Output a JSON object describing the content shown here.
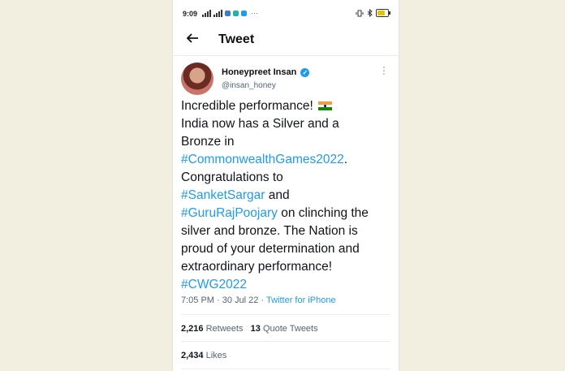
{
  "status_bar": {
    "time": "9:09",
    "dots": "···"
  },
  "header": {
    "title": "Tweet"
  },
  "tweet": {
    "display_name": "Honeypreet  Insan",
    "handle": "@insan_honey",
    "verified_mark": "✓",
    "more_glyph": "⋮",
    "lines": [
      "Incredible performance!",
      "India now has a Silver and a",
      "Bronze in",
      "#CommonwealthGames2022",
      ".",
      "Congratulations to",
      "#SanketSargar",
      " and",
      "#GuruRajPoojary",
      " on clinching the",
      "silver and bronze. The Nation is",
      "proud of your determination and",
      "extraordinary performance!",
      "#CWG2022"
    ],
    "timestamp": "7:05 PM · 30 Jul 22 · ",
    "source": "Twitter for iPhone",
    "retweets_count": "2,216",
    "retweets_label": "Retweets",
    "quote_count": "13",
    "quote_label": "Quote Tweets",
    "likes_count": "2,434",
    "likes_label": "Likes"
  },
  "colors": {
    "link": "#1d9bf0",
    "background": "#f2efe0"
  }
}
